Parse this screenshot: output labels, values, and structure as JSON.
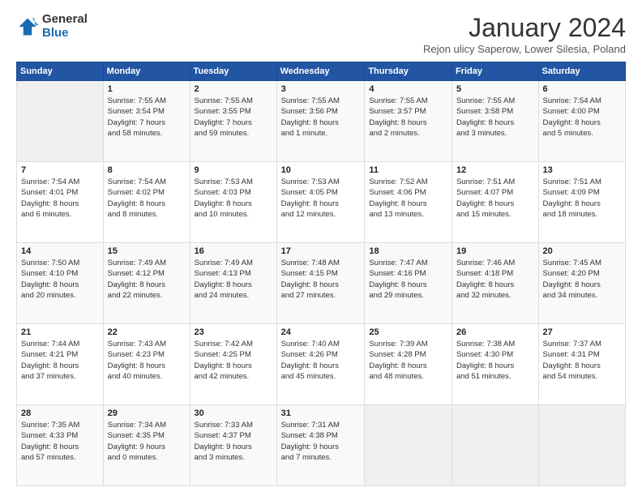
{
  "logo": {
    "general": "General",
    "blue": "Blue"
  },
  "header": {
    "month": "January 2024",
    "location": "Rejon ulicy Saperow, Lower Silesia, Poland"
  },
  "weekdays": [
    "Sunday",
    "Monday",
    "Tuesday",
    "Wednesday",
    "Thursday",
    "Friday",
    "Saturday"
  ],
  "weeks": [
    [
      {
        "day": "",
        "info": ""
      },
      {
        "day": "1",
        "info": "Sunrise: 7:55 AM\nSunset: 3:54 PM\nDaylight: 7 hours\nand 58 minutes."
      },
      {
        "day": "2",
        "info": "Sunrise: 7:55 AM\nSunset: 3:55 PM\nDaylight: 7 hours\nand 59 minutes."
      },
      {
        "day": "3",
        "info": "Sunrise: 7:55 AM\nSunset: 3:56 PM\nDaylight: 8 hours\nand 1 minute."
      },
      {
        "day": "4",
        "info": "Sunrise: 7:55 AM\nSunset: 3:57 PM\nDaylight: 8 hours\nand 2 minutes."
      },
      {
        "day": "5",
        "info": "Sunrise: 7:55 AM\nSunset: 3:58 PM\nDaylight: 8 hours\nand 3 minutes."
      },
      {
        "day": "6",
        "info": "Sunrise: 7:54 AM\nSunset: 4:00 PM\nDaylight: 8 hours\nand 5 minutes."
      }
    ],
    [
      {
        "day": "7",
        "info": "Sunrise: 7:54 AM\nSunset: 4:01 PM\nDaylight: 8 hours\nand 6 minutes."
      },
      {
        "day": "8",
        "info": "Sunrise: 7:54 AM\nSunset: 4:02 PM\nDaylight: 8 hours\nand 8 minutes."
      },
      {
        "day": "9",
        "info": "Sunrise: 7:53 AM\nSunset: 4:03 PM\nDaylight: 8 hours\nand 10 minutes."
      },
      {
        "day": "10",
        "info": "Sunrise: 7:53 AM\nSunset: 4:05 PM\nDaylight: 8 hours\nand 12 minutes."
      },
      {
        "day": "11",
        "info": "Sunrise: 7:52 AM\nSunset: 4:06 PM\nDaylight: 8 hours\nand 13 minutes."
      },
      {
        "day": "12",
        "info": "Sunrise: 7:51 AM\nSunset: 4:07 PM\nDaylight: 8 hours\nand 15 minutes."
      },
      {
        "day": "13",
        "info": "Sunrise: 7:51 AM\nSunset: 4:09 PM\nDaylight: 8 hours\nand 18 minutes."
      }
    ],
    [
      {
        "day": "14",
        "info": "Sunrise: 7:50 AM\nSunset: 4:10 PM\nDaylight: 8 hours\nand 20 minutes."
      },
      {
        "day": "15",
        "info": "Sunrise: 7:49 AM\nSunset: 4:12 PM\nDaylight: 8 hours\nand 22 minutes."
      },
      {
        "day": "16",
        "info": "Sunrise: 7:49 AM\nSunset: 4:13 PM\nDaylight: 8 hours\nand 24 minutes."
      },
      {
        "day": "17",
        "info": "Sunrise: 7:48 AM\nSunset: 4:15 PM\nDaylight: 8 hours\nand 27 minutes."
      },
      {
        "day": "18",
        "info": "Sunrise: 7:47 AM\nSunset: 4:16 PM\nDaylight: 8 hours\nand 29 minutes."
      },
      {
        "day": "19",
        "info": "Sunrise: 7:46 AM\nSunset: 4:18 PM\nDaylight: 8 hours\nand 32 minutes."
      },
      {
        "day": "20",
        "info": "Sunrise: 7:45 AM\nSunset: 4:20 PM\nDaylight: 8 hours\nand 34 minutes."
      }
    ],
    [
      {
        "day": "21",
        "info": "Sunrise: 7:44 AM\nSunset: 4:21 PM\nDaylight: 8 hours\nand 37 minutes."
      },
      {
        "day": "22",
        "info": "Sunrise: 7:43 AM\nSunset: 4:23 PM\nDaylight: 8 hours\nand 40 minutes."
      },
      {
        "day": "23",
        "info": "Sunrise: 7:42 AM\nSunset: 4:25 PM\nDaylight: 8 hours\nand 42 minutes."
      },
      {
        "day": "24",
        "info": "Sunrise: 7:40 AM\nSunset: 4:26 PM\nDaylight: 8 hours\nand 45 minutes."
      },
      {
        "day": "25",
        "info": "Sunrise: 7:39 AM\nSunset: 4:28 PM\nDaylight: 8 hours\nand 48 minutes."
      },
      {
        "day": "26",
        "info": "Sunrise: 7:38 AM\nSunset: 4:30 PM\nDaylight: 8 hours\nand 51 minutes."
      },
      {
        "day": "27",
        "info": "Sunrise: 7:37 AM\nSunset: 4:31 PM\nDaylight: 8 hours\nand 54 minutes."
      }
    ],
    [
      {
        "day": "28",
        "info": "Sunrise: 7:35 AM\nSunset: 4:33 PM\nDaylight: 8 hours\nand 57 minutes."
      },
      {
        "day": "29",
        "info": "Sunrise: 7:34 AM\nSunset: 4:35 PM\nDaylight: 9 hours\nand 0 minutes."
      },
      {
        "day": "30",
        "info": "Sunrise: 7:33 AM\nSunset: 4:37 PM\nDaylight: 9 hours\nand 3 minutes."
      },
      {
        "day": "31",
        "info": "Sunrise: 7:31 AM\nSunset: 4:38 PM\nDaylight: 9 hours\nand 7 minutes."
      },
      {
        "day": "",
        "info": ""
      },
      {
        "day": "",
        "info": ""
      },
      {
        "day": "",
        "info": ""
      }
    ]
  ]
}
